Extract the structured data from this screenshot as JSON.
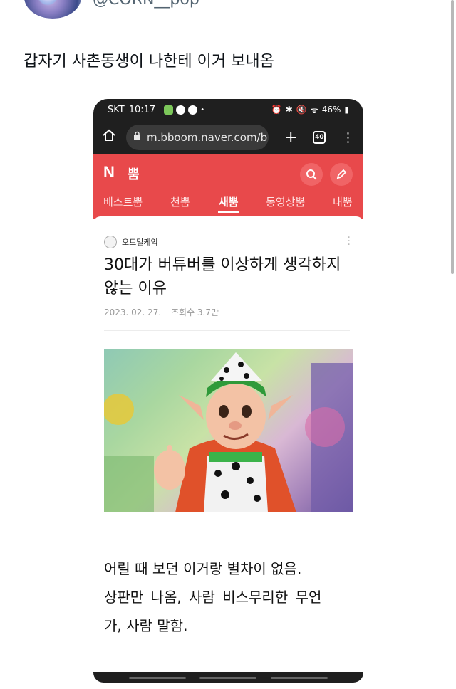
{
  "tweet": {
    "handle": "@CORN__pop",
    "text": "갑자기 사촌동생이 나한테 이거 보내옴"
  },
  "phone_status": {
    "carrier": "SKT",
    "time": "10:17",
    "battery": "46%"
  },
  "browser": {
    "url": "m.bboom.naver.com/b",
    "tab_count": "40"
  },
  "site": {
    "logo_n": "N",
    "logo_text": "뿜",
    "tabs": [
      "베스트뿜",
      "천뿜",
      "새뿜",
      "동영상뿜",
      "내뿜"
    ],
    "active_tab_index": 2
  },
  "post": {
    "author": "오트밀케익",
    "title": "30대가 버튜버를 이상하게 생각하지 않는 이유",
    "date": "2023. 02. 27.",
    "views": "조회수 3.7만",
    "body_lines": [
      "어릴 때 보던 이거랑 별차이 없음.",
      "상판만 나옴, 사람 비스무리한 무언",
      "가, 사람 말함."
    ]
  },
  "colors": {
    "brand_red": "#e8494b",
    "browser_dark": "#1f1f1f"
  }
}
